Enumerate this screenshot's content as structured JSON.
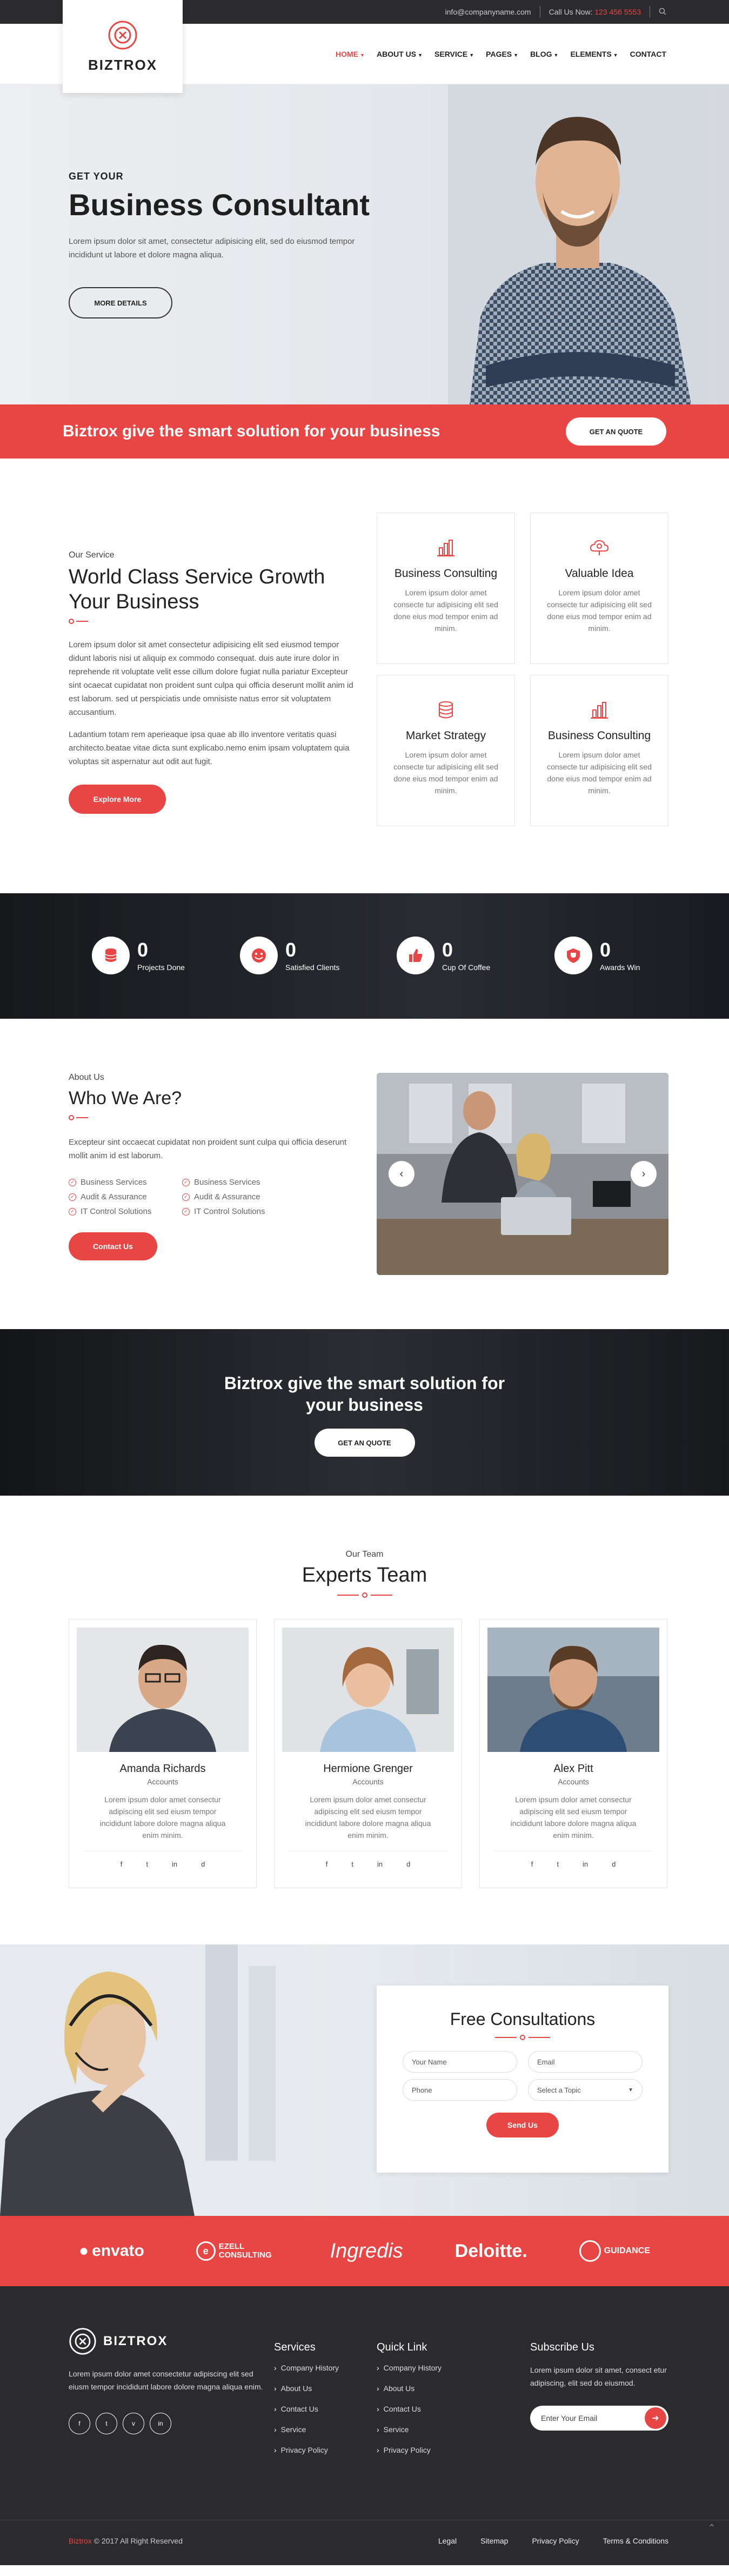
{
  "topbar": {
    "email": "info@companyname.com",
    "call_label": "Call Us Now:",
    "phone": "123 456 5553"
  },
  "brand": {
    "name": "BIZTROX",
    "accent": "#e84545"
  },
  "nav": {
    "items": [
      "HOME",
      "ABOUT US",
      "SERVICE",
      "PAGES",
      "BLOG",
      "ELEMENTS",
      "CONTACT"
    ]
  },
  "hero": {
    "subtitle": "GET YOUR",
    "title": "Business Consultant",
    "text": "Lorem ipsum dolor sit amet, consectetur adipisicing elit, sed do eiusmod tempor incididunt ut labore et dolore magna aliqua.",
    "button": "MORE DETAILS"
  },
  "strip": {
    "text": "Biztrox give the smart solution for your business",
    "button": "GET AN QUOTE"
  },
  "services": {
    "kicker": "Our Service",
    "title": "World Class Service Growth Your Business",
    "p1": "Lorem ipsum dolor sit amet consectetur adipisicing elit sed eiusmod tempor didunt laboris nisi ut aliquip ex commodo consequat. duis aute irure dolor in reprehende rit voluptate velit esse cillum dolore fugiat nulla pariatur Excepteur sint ocaecat cupidatat non proident sunt culpa qui officia deserunt mollit anim id est laborum. sed ut perspiciatis unde omnisiste natus error sit voluptatem accusantium.",
    "p2": "Ladantium totam rem aperieaque ipsa quae ab illo inventore veritatis quasi architecto.beatae vitae dicta sunt explicabo.nemo enim ipsam voluptatem quia voluptas sit aspernatur aut odit aut fugit.",
    "button": "Explore More",
    "cards": [
      {
        "icon": "bar-chart-icon",
        "title": "Business Consulting",
        "text": "Lorem ipsum dolor amet consecte tur adipisicing elit sed done eius mod tempor enim ad minim."
      },
      {
        "icon": "idea-cloud-icon",
        "title": "Valuable Idea",
        "text": "Lorem ipsum dolor amet consecte tur adipisicing elit sed done eius mod tempor enim ad minim."
      },
      {
        "icon": "coin-stack-icon",
        "title": "Market Strategy",
        "text": "Lorem ipsum dolor amet consecte tur adipisicing elit sed done eius mod tempor enim ad minim."
      },
      {
        "icon": "bar-chart-icon",
        "title": "Business Consulting",
        "text": "Lorem ipsum dolor amet consecte tur adipisicing elit sed done eius mod tempor enim ad minim."
      }
    ]
  },
  "counters": [
    {
      "icon": "database-icon",
      "value": "0",
      "label": "Projects Done"
    },
    {
      "icon": "smile-icon",
      "value": "0",
      "label": "Satisfied Clients"
    },
    {
      "icon": "thumbs-up-icon",
      "value": "0",
      "label": "Cup Of Coffee"
    },
    {
      "icon": "trophy-shield-icon",
      "value": "0",
      "label": "Awards Win"
    }
  ],
  "about": {
    "kicker": "About Us",
    "title": "Who We Are?",
    "text": "Excepteur sint occaecat cupidatat non proident sunt culpa qui officia deserunt mollit anim id est laborum.",
    "checks": [
      "Business Services",
      "Business Services",
      "Audit & Assurance",
      "Audit & Assurance",
      "IT Control Solutions",
      "IT Control Solutions"
    ],
    "button": "Contact Us"
  },
  "cta": {
    "title": "Biztrox give the smart solution for your business",
    "button": "GET AN QUOTE"
  },
  "team": {
    "kicker": "Our Team",
    "title": "Experts Team",
    "members": [
      {
        "name": "Amanda Richards",
        "role": "Accounts",
        "text": "Lorem ipsum dolor amet consectur adipiscing elit sed eiusm tempor incididunt labore dolore magna aliqua enim minim."
      },
      {
        "name": "Hermione Grenger",
        "role": "Accounts",
        "text": "Lorem ipsum dolor amet consectur adipiscing elit sed eiusm tempor incididunt labore dolore magna aliqua enim minim."
      },
      {
        "name": "Alex Pitt",
        "role": "Accounts",
        "text": "Lorem ipsum dolor amet consectur adipiscing elit sed eiusm tempor incididunt labore dolore magna aliqua enim minim."
      }
    ],
    "social": [
      "f",
      "t",
      "in",
      "d"
    ]
  },
  "consult": {
    "title": "Free Consultations",
    "name_placeholder": "Your Name",
    "email_placeholder": "Email",
    "phone_placeholder": "Phone",
    "topic": "Select a Topic",
    "button": "Send Us"
  },
  "brands": [
    "envato",
    "EZELL CONSULTING",
    "Ingredis",
    "Deloitte.",
    "GUIDANCE"
  ],
  "footer": {
    "about": "Lorem ipsum dolor amet consectetur adipiscing elit sed eiusm tempor incididunt labore dolore magna aliqua enim.",
    "social": [
      "f",
      "t",
      "v",
      "in"
    ],
    "services_title": "Services",
    "services": [
      "Company History",
      "About Us",
      "Contact Us",
      "Service",
      "Privacy Policy"
    ],
    "quick_title": "Quick Link",
    "quick": [
      "Company History",
      "About Us",
      "Contact Us",
      "Service",
      "Privacy Policy"
    ],
    "subscribe_title": "Subscribe Us",
    "subscribe_text": "Lorem ipsum dolor sit amet, consect etur adipiscing, elit sed do eiusmod.",
    "email_placeholder": "Enter Your Email"
  },
  "bottom": {
    "brand": "Biztrox",
    "copyright": " © 2017 All Right Reserved",
    "links": [
      "Legal",
      "Sitemap",
      "Privacy Policy",
      "Terms & Conditions"
    ]
  }
}
